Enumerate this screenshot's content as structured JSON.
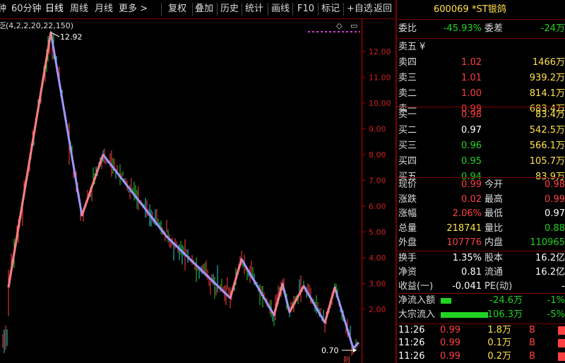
{
  "toolbar": {
    "partial": "钟",
    "items": [
      "60分钟",
      "日线",
      "周线",
      "月线",
      "更多 >",
      "复权",
      "叠加",
      "历史",
      "统计",
      "画线",
      "F10",
      "标记",
      "+自选",
      "返回"
    ],
    "active_index": 1
  },
  "chart": {
    "indicator_label": "(4,2,2,20,22,150)",
    "partial_prefix": "乏",
    "price_labels": [
      "12.00",
      "11.00",
      "10.00",
      "9.00",
      "8.00",
      "7.00",
      "6.00",
      "5.00",
      "4.00",
      "3.00",
      "2.00"
    ],
    "high_marker": "12.92",
    "low_marker": "0.70",
    "right_icons": [
      "◇",
      "▭"
    ],
    "bottom_partial": "则"
  },
  "header": {
    "code": "600069",
    "name": "*ST银鸽"
  },
  "weibi": {
    "label1": "委比",
    "value1": "-45.93%",
    "label2": "委差",
    "value2": "-24万"
  },
  "sell": [
    {
      "label": "卖五",
      "price": "",
      "volume": "",
      "extra": "¥"
    },
    {
      "label": "卖四",
      "price": "1.02",
      "volume": "1466万"
    },
    {
      "label": "卖三",
      "price": "1.01",
      "volume": "939.2万"
    },
    {
      "label": "卖二",
      "price": "1.00",
      "volume": "814.1万"
    },
    {
      "label": "卖一",
      "price": "0.99",
      "volume": "683.4万"
    }
  ],
  "buy": [
    {
      "label": "买一",
      "price": "0.98",
      "volume": "83.4万",
      "color": "red"
    },
    {
      "label": "买二",
      "price": "0.97",
      "volume": "542.5万",
      "color": "white"
    },
    {
      "label": "买三",
      "price": "0.96",
      "volume": "566.1万",
      "color": "green"
    },
    {
      "label": "买四",
      "price": "0.95",
      "volume": "105.7万",
      "color": "green"
    },
    {
      "label": "买五",
      "price": "0.94",
      "volume": "83.9万",
      "color": "green"
    }
  ],
  "stats": [
    {
      "l1": "现价",
      "v1": "0.99",
      "c1": "red",
      "l2": "今开",
      "v2": "0.98",
      "c2": "red"
    },
    {
      "l1": "涨跌",
      "v1": "0.02",
      "c1": "red",
      "l2": "最高",
      "v2": "0.99",
      "c2": "red"
    },
    {
      "l1": "涨幅",
      "v1": "2.06%",
      "c1": "red",
      "l2": "最低",
      "v2": "0.97",
      "c2": "white"
    },
    {
      "l1": "总量",
      "v1": "218741",
      "c1": "yellow",
      "l2": "量比",
      "v2": "0.88",
      "c2": "green"
    },
    {
      "l1": "外盘",
      "v1": "107776",
      "c1": "red",
      "l2": "内盘",
      "v2": "110965",
      "c2": "green"
    }
  ],
  "stats2": [
    {
      "l1": "换手",
      "v1": "1.35%",
      "l2": "股本",
      "v2": "16.2亿"
    },
    {
      "l1": "净资",
      "v1": "0.81",
      "l2": "流通",
      "v2": "16.2亿"
    },
    {
      "l1": "收益(一)",
      "v1": "-0.041",
      "l2": "PE(动)",
      "v2": "-"
    }
  ],
  "flows": [
    {
      "label": "净流入额",
      "value": "-24.6万",
      "pct": "-1%",
      "bar": 0.22
    },
    {
      "label": "大宗流入",
      "value": "-106.3万",
      "pct": "-5%",
      "bar": 0.95
    }
  ],
  "ticks": [
    {
      "time": "11:26",
      "price": "0.99",
      "vol": "1.8万",
      "side": "B"
    },
    {
      "time": "11:26",
      "price": "0.99",
      "vol": "0.1万",
      "side": "B"
    },
    {
      "time": "11:26",
      "price": "0.99",
      "vol": "0.2万",
      "side": "B"
    }
  ],
  "colors": {
    "up": "#ff4040",
    "down": "#21d321",
    "zigzag": "#9f97ff",
    "axis": "#cc0000"
  }
}
